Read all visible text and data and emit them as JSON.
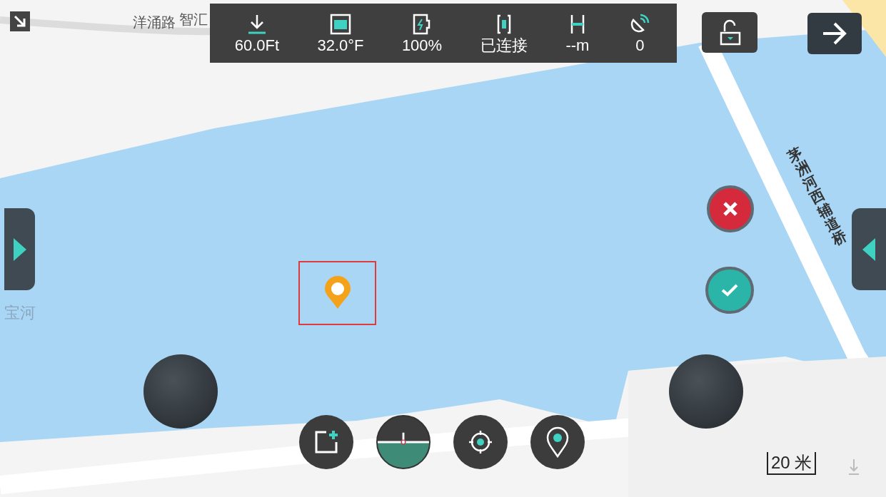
{
  "map": {
    "labels": [
      {
        "kind": "road",
        "text": "洋涌路"
      },
      {
        "kind": "place",
        "text": "智汇"
      },
      {
        "kind": "water",
        "text": "宝河"
      },
      {
        "kind": "bridge",
        "text": "茅洲河西辅道桥"
      }
    ],
    "scale": "20 米",
    "marker": {
      "selected": true
    }
  },
  "status_bar": [
    {
      "kind": "altitude",
      "value": "60.0Ft"
    },
    {
      "kind": "temperature",
      "value": "32.0°F"
    },
    {
      "kind": "battery",
      "value": "100%"
    },
    {
      "kind": "link",
      "value": "已连接"
    },
    {
      "kind": "height",
      "value": "--m"
    },
    {
      "kind": "satellite",
      "value": "0"
    }
  ]
}
